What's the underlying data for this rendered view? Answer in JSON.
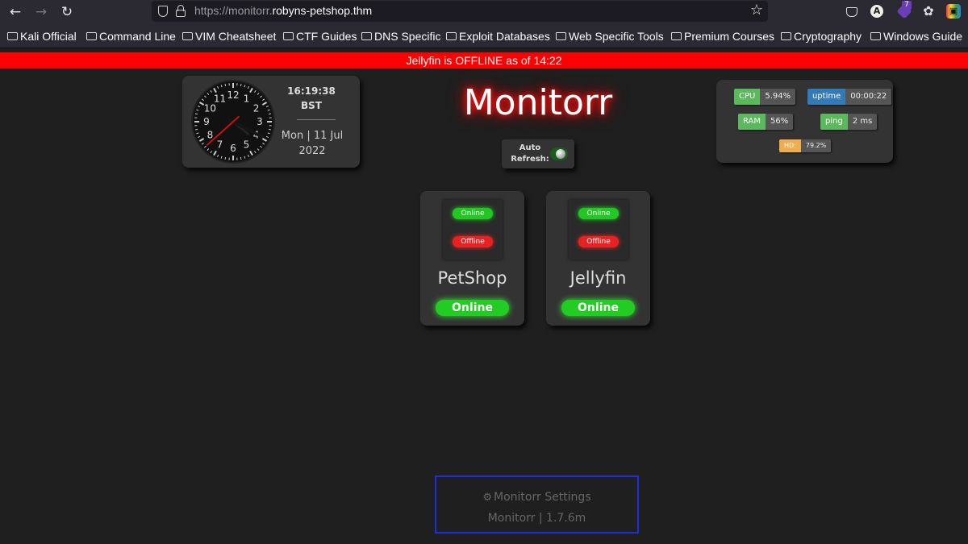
{
  "browser": {
    "url_prefix": "https://monitorr.",
    "url_host": "robyns-petshop.thm",
    "bookmarks": [
      "Kali Official",
      "Command Line",
      "VIM Cheatsheet",
      "CTF Guides",
      "DNS Specific",
      "Exploit Databases",
      "Web Specific Tools",
      "Premium Courses",
      "Cryptography",
      "Windows Guide"
    ],
    "ext_badge": "7",
    "account_letter": "A"
  },
  "alert": {
    "text": "Jellyfin is OFFLINE as of 14:22",
    "color": "#ff0000"
  },
  "clock": {
    "time": "16:19:38",
    "timezone": "BST",
    "date_line1": "Mon | 11 Jul",
    "date_line2": "2022",
    "numerals": [
      "12",
      "1",
      "2",
      "3",
      "4",
      "5",
      "6",
      "7",
      "8",
      "9",
      "10",
      "11"
    ]
  },
  "title": "Monitorr",
  "autorefresh": {
    "label_line1": "Auto",
    "label_line2": "Refresh:",
    "enabled": true
  },
  "stats": {
    "cpu": {
      "label": "CPU",
      "value": "5.94%",
      "color": "#5cb85c"
    },
    "uptime": {
      "label": "uptime",
      "value": "00:00:22",
      "color": "#337ab7"
    },
    "ram": {
      "label": "RAM",
      "value": "56%",
      "color": "#5cb85c"
    },
    "ping": {
      "label": "ping",
      "value": "2 ms",
      "color": "#5cb85c"
    },
    "hd": {
      "label": "HD:",
      "value": "79.2%",
      "color": "#f0ad4e"
    }
  },
  "services": [
    {
      "name": "PetShop",
      "status": "Online",
      "legend_online": "Online",
      "legend_offline": "Offline"
    },
    {
      "name": "Jellyfin",
      "status": "Online",
      "legend_online": "Online",
      "legend_offline": "Offline"
    }
  ],
  "footer": {
    "settings_label": "Monitorr Settings",
    "version": "Monitorr | 1.7.6m"
  }
}
